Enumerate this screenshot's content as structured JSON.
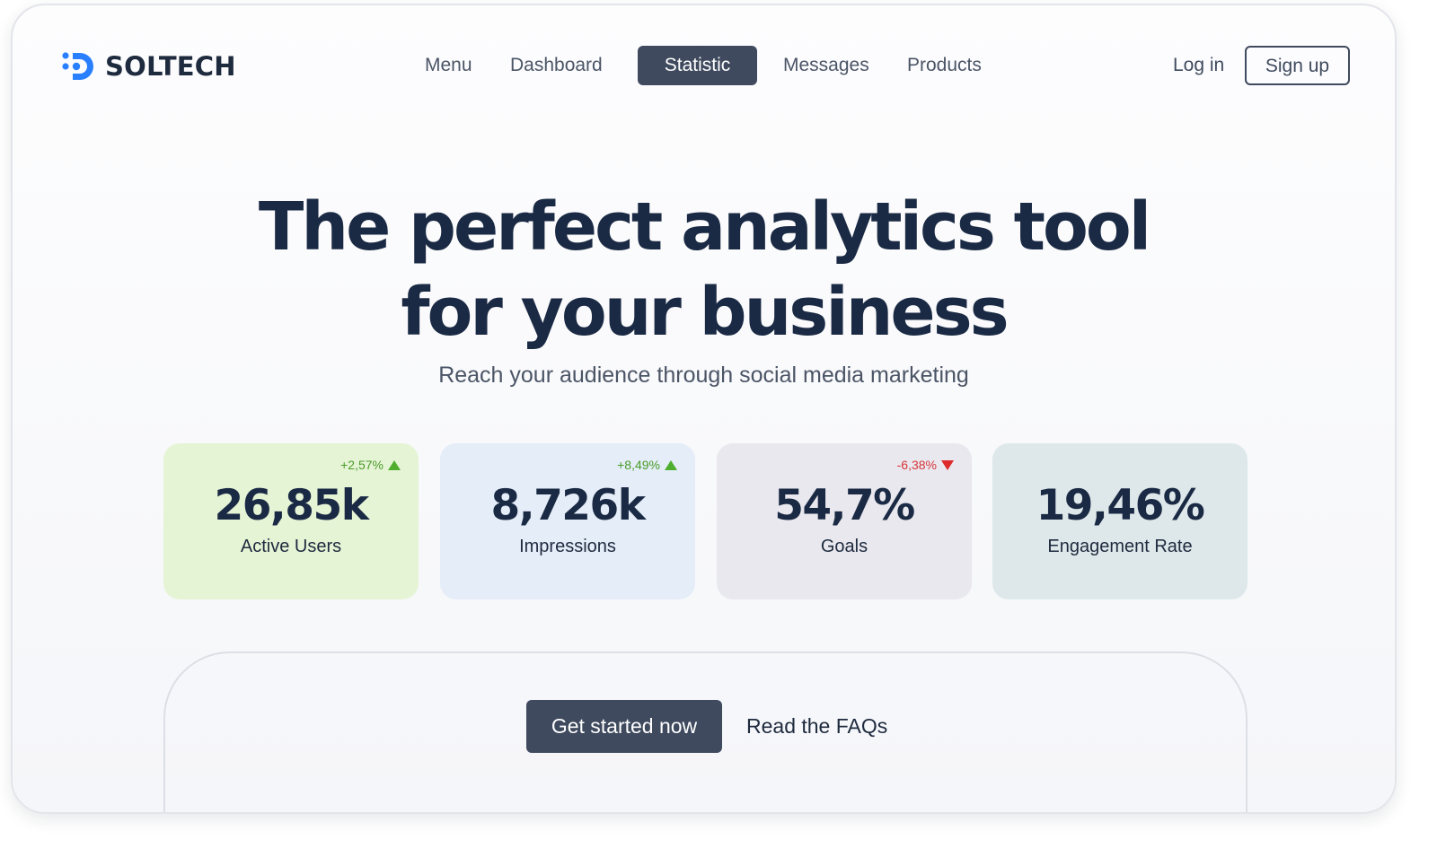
{
  "brand": {
    "name": "SOLTECH",
    "accent": "#2a7fff",
    "primary": "#3f4a5e"
  },
  "nav": {
    "items": [
      {
        "label": "Menu"
      },
      {
        "label": "Dashboard"
      },
      {
        "label": "Statistic",
        "active": true
      },
      {
        "label": "Messages"
      },
      {
        "label": "Products"
      }
    ]
  },
  "auth": {
    "login": "Log in",
    "signup": "Sign up"
  },
  "hero": {
    "title_line1": "The perfect analytics tool",
    "title_line2": "for your business",
    "subtitle": "Reach your audience through social media marketing"
  },
  "stats": [
    {
      "value": "26,85k",
      "label": "Active Users",
      "change": "+2,57%",
      "trend": "up",
      "bg": "#e6f4d6"
    },
    {
      "value": "8,726k",
      "label": "Impressions",
      "change": "+8,49%",
      "trend": "up",
      "bg": "#e4edf8"
    },
    {
      "value": "54,7%",
      "label": "Goals",
      "change": "-6,38%",
      "trend": "down",
      "bg": "#e9e8ee"
    },
    {
      "value": "19,46%",
      "label": "Engagement Rate",
      "change": "",
      "trend": "none",
      "bg": "#dee8ea"
    }
  ],
  "cta": {
    "primary": "Get started now",
    "secondary": "Read the FAQs"
  },
  "icons": {
    "up": "triangle-up-icon",
    "down": "triangle-down-icon",
    "logo": "soltech-logo-icon"
  }
}
